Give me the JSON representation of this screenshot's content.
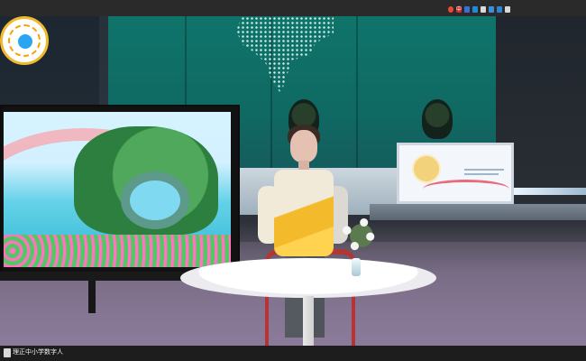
{
  "top_bar": {
    "tray_icons": [
      {
        "name": "network-icon",
        "label": ""
      },
      {
        "name": "input-method-icon",
        "label": "中"
      },
      {
        "name": "moon-icon",
        "label": ""
      },
      {
        "name": "mic-icon",
        "label": ""
      },
      {
        "name": "keyboard-icon",
        "label": ""
      },
      {
        "name": "shirt-icon",
        "label": ""
      },
      {
        "name": "grid-icon",
        "label": ""
      },
      {
        "name": "wrench-icon",
        "label": ""
      }
    ]
  },
  "status_bar": {
    "caption": "理正中小学数字人"
  },
  "scene": {
    "logo_name": "school-logo",
    "left_screen": "scenic-landscape",
    "right_screen": "ai-presentation-screen",
    "accent": "#f0ba2e",
    "wall": "#0f746b"
  }
}
